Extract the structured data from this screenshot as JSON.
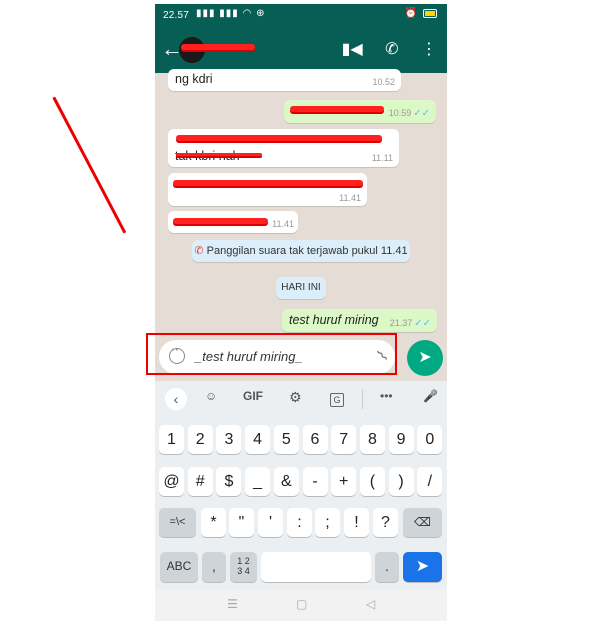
{
  "status": {
    "time": "22.57",
    "signal": "▮▮▮ ▮▮▮ ◠ ⊕",
    "right": "⏰"
  },
  "header": {
    "back_icon": "arrow-left-icon",
    "video_icon": "videocam-icon",
    "call_icon": "phone-icon",
    "menu_icon": "more-vert-icon"
  },
  "chat": {
    "messages": [
      {
        "dir": "in",
        "text": "ng kdri",
        "time": "10.52"
      },
      {
        "dir": "out",
        "text": "",
        "time": "10.59",
        "ticks": "✓✓"
      },
      {
        "dir": "in",
        "text": "tak kbri nah",
        "time": "11.11"
      },
      {
        "dir": "in",
        "text": "",
        "time": "11.41"
      },
      {
        "dir": "in",
        "text": "",
        "time": "11.41"
      },
      {
        "dir": "out",
        "text": "test huruf miring",
        "time": "21.37",
        "ticks": "✓✓"
      }
    ],
    "missed_call": "Panggilan suara tak terjawab pukul 11.41",
    "date_divider": "HARI INI"
  },
  "input": {
    "value": "_test huruf miring_",
    "send_icon": "send-icon"
  },
  "keyboard": {
    "toolbar": {
      "back": "‹",
      "sticker": "☺",
      "gif": "GIF",
      "settings": "⚙",
      "translate": "G",
      "more": "•••",
      "mic": "🎤"
    },
    "row1": [
      "1",
      "2",
      "3",
      "4",
      "5",
      "6",
      "7",
      "8",
      "9",
      "0"
    ],
    "row2": [
      "@",
      "#",
      "$",
      "_",
      "&",
      "-",
      "+",
      "(",
      ")",
      "/"
    ],
    "row3": [
      "=\\<",
      "*",
      "\"",
      "'",
      ":",
      ";",
      "!",
      "?",
      "⌫"
    ],
    "row4": {
      "abc": "ABC",
      "comma": ",",
      "numpad": "1 2\n3 4",
      "period": ".",
      "enter": "➤"
    }
  },
  "navbar": {
    "menu": "☰",
    "home": "▢",
    "back": "◁"
  }
}
